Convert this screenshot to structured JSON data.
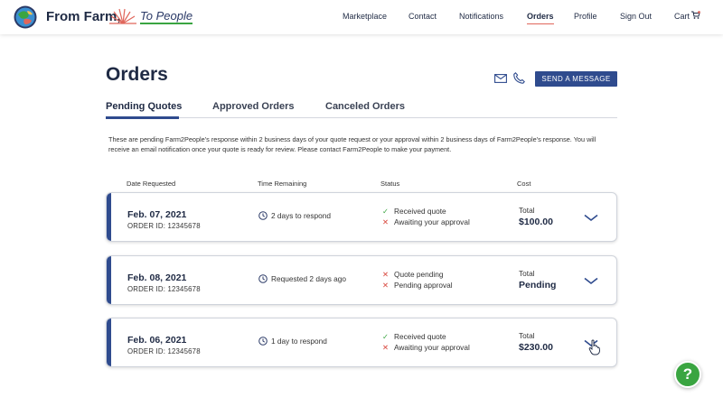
{
  "header": {
    "brand_part1": "From Farm,",
    "brand_part2": "To People",
    "nav": [
      {
        "label": "Marketplace"
      },
      {
        "label": "Contact"
      },
      {
        "label": "Notifications"
      },
      {
        "label": "Orders",
        "active": true
      },
      {
        "label": "Profile"
      },
      {
        "label": "Sign Out"
      },
      {
        "label": "Cart"
      }
    ],
    "icons": {
      "logo": "globe-logo-icon",
      "accent": "sunburst-icon",
      "cart": "cart-icon"
    }
  },
  "page": {
    "title": "Orders",
    "send_button": "SEND A MESSAGE",
    "icons": {
      "mail": "mail-icon",
      "phone": "phone-icon"
    }
  },
  "tabs": [
    {
      "label": "Pending Quotes",
      "active": true
    },
    {
      "label": "Approved Orders"
    },
    {
      "label": "Canceled Orders"
    }
  ],
  "intro": "These are pending Farm2People’s response within 2 business days of your quote request or your approval within 2 business days of Farm2People’s response. You will receive an email notification once your quote is ready for review. Please contact Farm2People to make your payment.",
  "columns": {
    "date": "Date Requested",
    "time": "Time Remaining",
    "status": "Status",
    "cost": "Cost"
  },
  "orders": [
    {
      "date": "Feb. 07, 2021",
      "order_id": "ORDER ID: 12345678",
      "time_remaining": "2 days to respond",
      "status": [
        {
          "text": "Received quote",
          "ok": true
        },
        {
          "text": "Awaiting your approval",
          "ok": false
        }
      ],
      "total_label": "Total",
      "total": "$100.00"
    },
    {
      "date": "Feb. 08, 2021",
      "order_id": "ORDER ID: 12345678",
      "time_remaining": "Requested 2 days ago",
      "status": [
        {
          "text": "Quote pending",
          "ok": false
        },
        {
          "text": "Pending approval",
          "ok": false
        }
      ],
      "total_label": "Total",
      "total": "Pending"
    },
    {
      "date": "Feb. 06, 2021",
      "order_id": "ORDER ID: 12345678",
      "time_remaining": "1 day to respond",
      "status": [
        {
          "text": "Received quote",
          "ok": true
        },
        {
          "text": "Awaiting your approval",
          "ok": false
        }
      ],
      "total_label": "Total",
      "total": "$230.00"
    }
  ],
  "help_button": "?",
  "colors": {
    "navy": "#2f4b8e",
    "green": "#3aa541",
    "red": "#d8453b",
    "nav_active_underline": "#e0665b"
  }
}
